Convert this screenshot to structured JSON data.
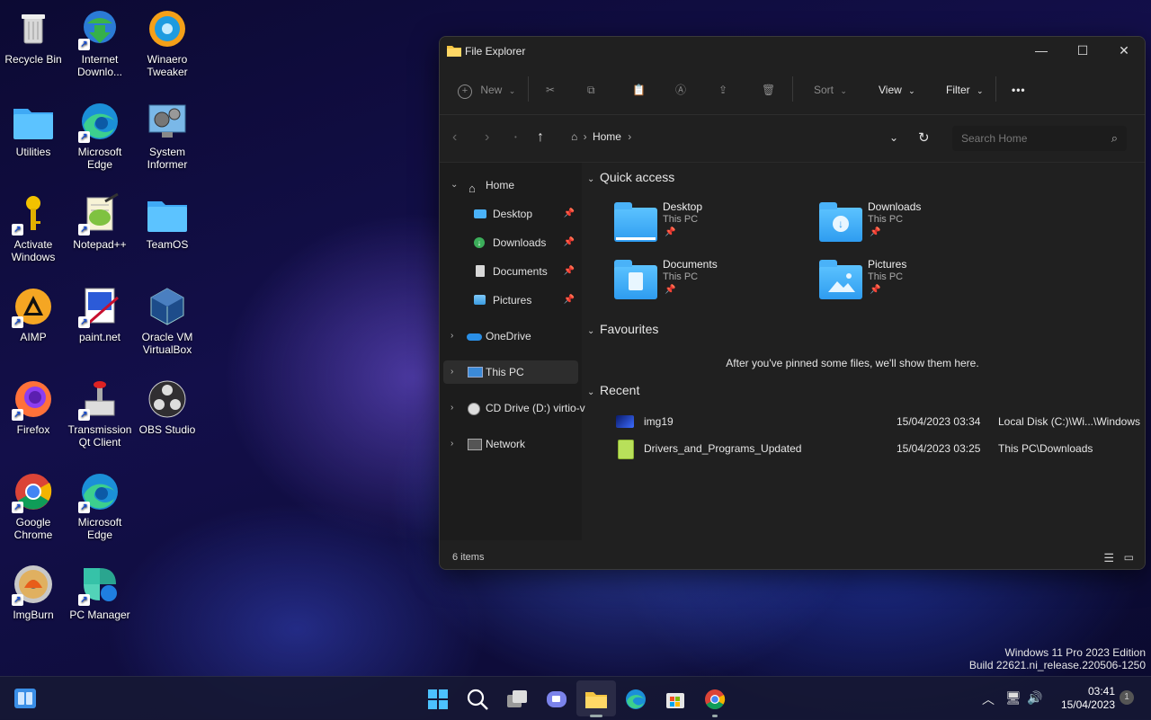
{
  "desktop": {
    "icons": [
      {
        "label": "Recycle Bin",
        "icon": "recycle-bin-icon"
      },
      {
        "label": "Internet Downlo...",
        "icon": "idm-icon"
      },
      {
        "label": "Winaero Tweaker",
        "icon": "winaero-icon"
      },
      {
        "label": "Utilities",
        "icon": "folder-icon"
      },
      {
        "label": "Microsoft Edge",
        "icon": "edge-icon"
      },
      {
        "label": "System Informer",
        "icon": "system-informer-icon"
      },
      {
        "label": "Activate Windows",
        "icon": "key-icon"
      },
      {
        "label": "Notepad++",
        "icon": "notepadpp-icon"
      },
      {
        "label": "TeamOS",
        "icon": "folder-icon"
      },
      {
        "label": "AIMP",
        "icon": "aimp-icon"
      },
      {
        "label": "paint.net",
        "icon": "paintnet-icon"
      },
      {
        "label": "Oracle VM VirtualBox",
        "icon": "virtualbox-icon"
      },
      {
        "label": "Firefox",
        "icon": "firefox-icon"
      },
      {
        "label": "Transmission Qt Client",
        "icon": "transmission-icon"
      },
      {
        "label": "OBS Studio",
        "icon": "obs-icon"
      },
      {
        "label": "Google Chrome",
        "icon": "chrome-icon"
      },
      {
        "label": "Microsoft Edge",
        "icon": "edge-icon"
      },
      {
        "label": "ImgBurn",
        "icon": "imgburn-icon"
      },
      {
        "label": "PC Manager",
        "icon": "pc-manager-icon"
      }
    ],
    "watermark": {
      "line1": "Windows 11 Pro 2023 Edition",
      "line2": "Build 22621.ni_release.220506-1250"
    }
  },
  "explorer": {
    "title": "File Explorer",
    "toolbar": {
      "new_label": "New",
      "sort_label": "Sort",
      "view_label": "View",
      "filter_label": "Filter",
      "more_label": "•••"
    },
    "address": {
      "crumb": "Home",
      "search_placeholder": "Search Home"
    },
    "sidebar": {
      "items": [
        {
          "label": "Home",
          "icon": "home-icon"
        },
        {
          "label": "Desktop",
          "icon": "desktop-folder-icon"
        },
        {
          "label": "Downloads",
          "icon": "downloads-icon"
        },
        {
          "label": "Documents",
          "icon": "documents-icon"
        },
        {
          "label": "Pictures",
          "icon": "pictures-icon"
        },
        {
          "label": "OneDrive",
          "icon": "onedrive-icon"
        },
        {
          "label": "This PC",
          "icon": "this-pc-icon"
        },
        {
          "label": "CD Drive (D:) virtio-v",
          "icon": "cd-drive-icon"
        },
        {
          "label": "Network",
          "icon": "network-icon"
        }
      ]
    },
    "quick_access": {
      "heading": "Quick access",
      "items": [
        {
          "name": "Desktop",
          "location": "This PC"
        },
        {
          "name": "Downloads",
          "location": "This PC"
        },
        {
          "name": "Documents",
          "location": "This PC"
        },
        {
          "name": "Pictures",
          "location": "This PC"
        }
      ]
    },
    "favourites": {
      "heading": "Favourites",
      "empty_message": "After you've pinned some files, we'll show them here."
    },
    "recent": {
      "heading": "Recent",
      "rows": [
        {
          "name": "img19",
          "date": "15/04/2023 03:34",
          "location": "Local Disk (C:)\\Wi...\\Windows"
        },
        {
          "name": "Drivers_and_Programs_Updated",
          "date": "15/04/2023 03:25",
          "location": "This PC\\Downloads"
        }
      ]
    },
    "status": {
      "item_count": "6 items"
    }
  },
  "taskbar": {
    "clock_time": "03:41",
    "clock_date": "15/04/2023",
    "notification_count": "1"
  },
  "colors": {
    "window_bg": "#202020",
    "folder_blue": "#4ab2f8",
    "accent": "#0078d4"
  }
}
